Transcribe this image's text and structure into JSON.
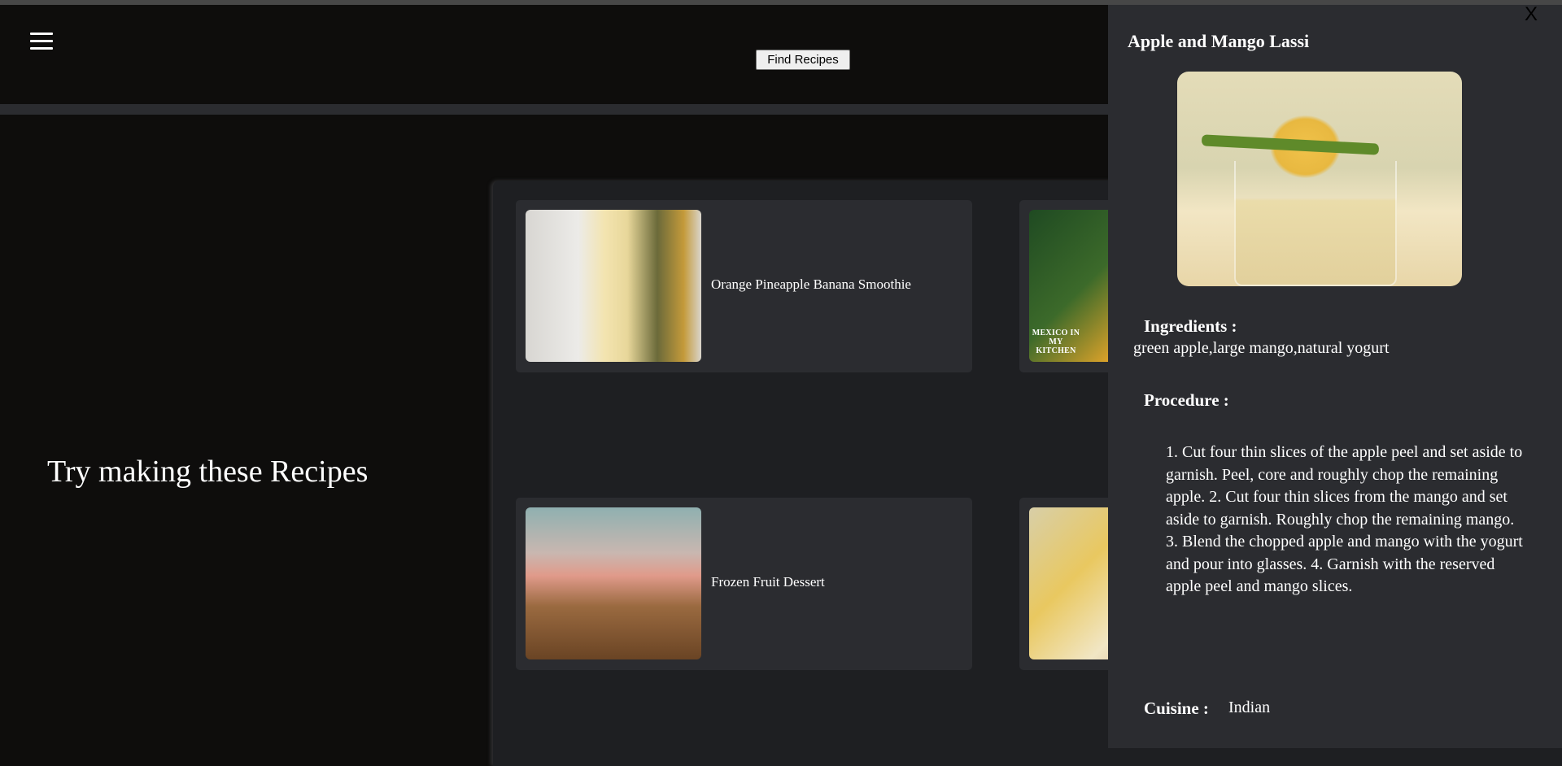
{
  "header": {
    "menu_icon": "hamburger-icon",
    "find_button": "Find Recipes"
  },
  "hero": {
    "title": "Try making these Recipes"
  },
  "recipes": [
    {
      "name": "Orange Pineapple Banana Smoothie"
    },
    {
      "name": ""
    },
    {
      "name": "Frozen Fruit Dessert"
    },
    {
      "name": ""
    }
  ],
  "card_image_text": {
    "mexico_kitchen": "MEXICO IN MY KITCHEN"
  },
  "detail": {
    "close": "X",
    "title": "Apple and Mango Lassi",
    "ingredients_label": "Ingredients :",
    "ingredients": "green apple,large mango,natural yogurt",
    "procedure_label": "Procedure :",
    "procedure": "1. Cut four thin slices of the apple peel and set aside to garnish. Peel, core and roughly chop the remaining apple. 2. Cut four thin slices from the mango and set aside to garnish. Roughly chop the remaining mango. 3. Blend the chopped apple and mango with the yogurt and pour into glasses. 4. Garnish with the reserved apple peel and mango slices.",
    "cuisine_label": "Cuisine :",
    "cuisine": "Indian"
  }
}
